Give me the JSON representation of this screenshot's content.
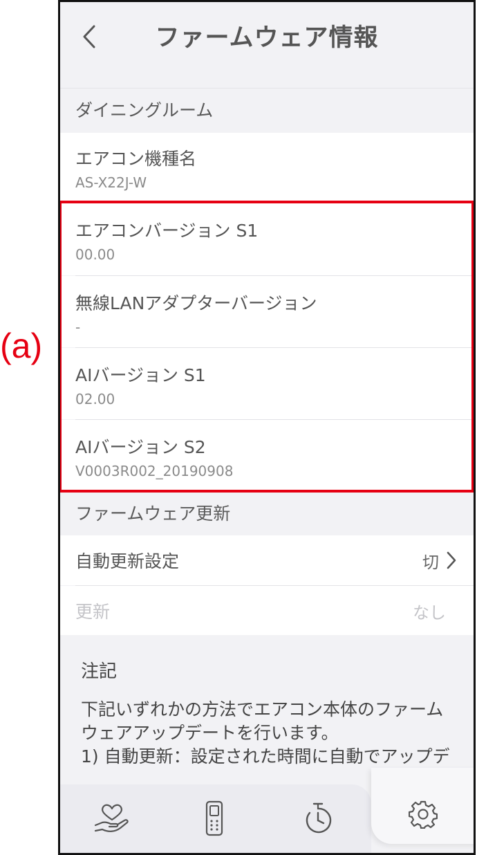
{
  "annotation": {
    "label": "(a)"
  },
  "header": {
    "title": "ファームウェア情報"
  },
  "room": {
    "name": "ダイニングルーム"
  },
  "info": [
    {
      "label": "エアコン機種名",
      "value": "AS-X22J-W"
    },
    {
      "label": "エアコンバージョン S1",
      "value": "00.00"
    },
    {
      "label": "無線LANアダプターバージョン",
      "value": "-"
    },
    {
      "label": "AIバージョン S1",
      "value": "02.00"
    },
    {
      "label": "AIバージョン S2",
      "value": "V0003R002_20190908"
    }
  ],
  "firmware_update": {
    "section": "ファームウェア更新",
    "auto_update": {
      "label": "自動更新設定",
      "value": "切"
    },
    "update": {
      "label": "更新",
      "value": "なし"
    }
  },
  "notes": {
    "title": "注記",
    "line1": "下記いずれかの方法でエアコン本体のファーム",
    "line2": "ウェアアップデートを行います。",
    "line3": "1) 自動更新：設定された時間に自動でアップデ"
  },
  "tabs": [
    {
      "name": "care",
      "icon": "heart-hand-icon"
    },
    {
      "name": "remote",
      "icon": "remote-control-icon"
    },
    {
      "name": "timer",
      "icon": "timer-icon"
    },
    {
      "name": "settings",
      "icon": "gear-icon"
    }
  ],
  "colors": {
    "highlight": "#e60012",
    "background": "#f2f2f5"
  }
}
